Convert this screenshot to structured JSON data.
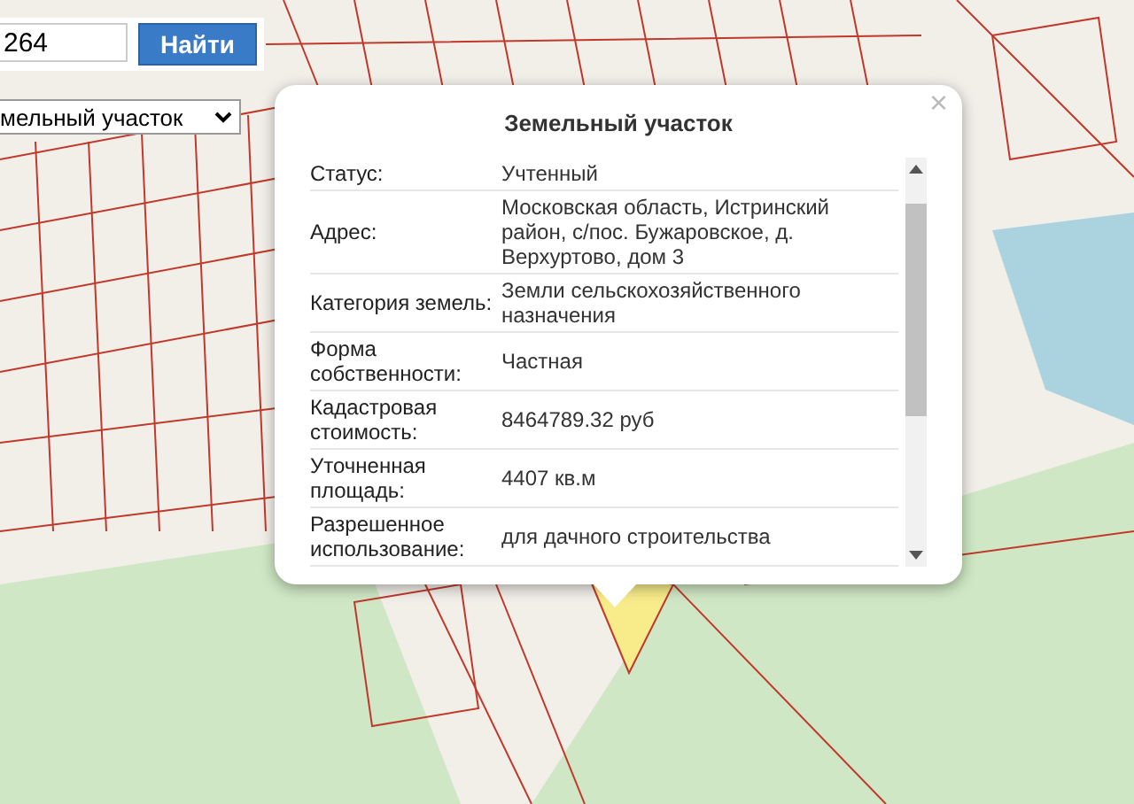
{
  "search": {
    "value": "264",
    "button": "Найти"
  },
  "type_select": {
    "value": "мельный участок"
  },
  "popup": {
    "title": "Земельный участок",
    "close": "×",
    "rows": [
      {
        "label": "Статус:",
        "value": "Учтенный"
      },
      {
        "label": "Адрес:",
        "value": "Московская область, Истринский район, с/пос. Бужаровское, д. Верхуртово, дом 3"
      },
      {
        "label": "Категория земель:",
        "value": "Земли сельскохозяйственного назначения"
      },
      {
        "label": "Форма собственности:",
        "value": "Частная"
      },
      {
        "label": "Кадастровая стоимость:",
        "value": "8464789.32 руб"
      },
      {
        "label": "Уточненная площадь:",
        "value": "4407 кв.м"
      },
      {
        "label": "Разрешенное использование:",
        "value": "для дачного строительства"
      }
    ]
  }
}
